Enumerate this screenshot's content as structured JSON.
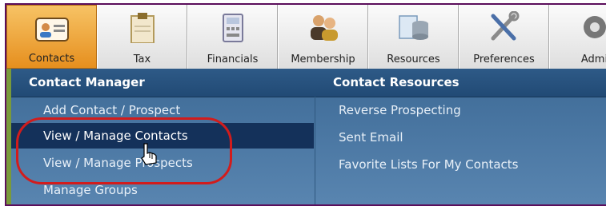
{
  "toolbar": {
    "tabs": [
      {
        "label": "Contacts",
        "icon": "contact-card-icon",
        "active": true
      },
      {
        "label": "Tax",
        "icon": "clipboard-icon",
        "active": false
      },
      {
        "label": "Financials",
        "icon": "calculator-icon",
        "active": false
      },
      {
        "label": "Membership",
        "icon": "people-icon",
        "active": false
      },
      {
        "label": "Resources",
        "icon": "database-icon",
        "active": false
      },
      {
        "label": "Preferences",
        "icon": "tools-icon",
        "active": false
      },
      {
        "label": "Admi",
        "icon": "gear-icon",
        "active": false
      }
    ]
  },
  "menu": {
    "contact_manager": {
      "title": "Contact Manager",
      "items": [
        "Add Contact / Prospect",
        "View / Manage Contacts",
        "View / Manage Prospects",
        "Manage Groups"
      ],
      "highlighted": "View / Manage Contacts"
    },
    "contact_resources": {
      "title": "Contact Resources",
      "items": [
        "Reverse Prospecting",
        "Sent Email",
        "Favorite Lists For My Contacts"
      ]
    }
  },
  "colors": {
    "active_tab": "#e68f1e",
    "menu_bg": "#3d6a96",
    "highlight": "#14315a",
    "annotation_oval": "#d21c1c"
  }
}
